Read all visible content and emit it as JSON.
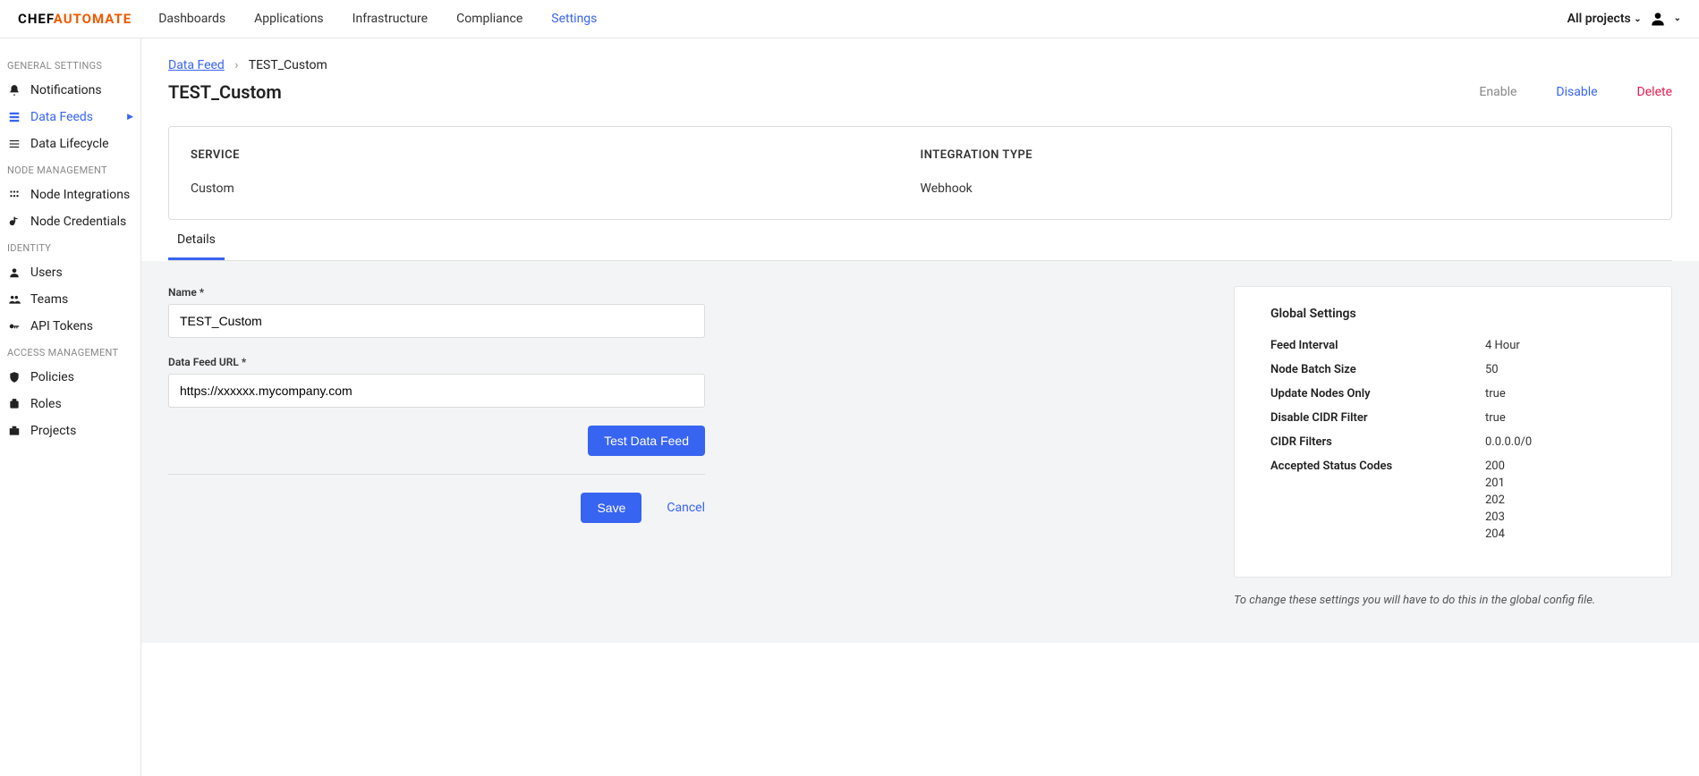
{
  "logo": {
    "chef": "CHEF",
    "automate": "AUTOMATE"
  },
  "topnav": [
    "Dashboards",
    "Applications",
    "Infrastructure",
    "Compliance",
    "Settings"
  ],
  "topnav_active": 4,
  "projects_label": "All projects",
  "sidebar": {
    "groups": [
      {
        "title": "GENERAL SETTINGS",
        "items": [
          {
            "label": "Notifications",
            "icon": "bell"
          },
          {
            "label": "Data Feeds",
            "icon": "feed",
            "active": true,
            "arrow": true
          },
          {
            "label": "Data Lifecycle",
            "icon": "lifecycle"
          }
        ]
      },
      {
        "title": "NODE MANAGEMENT",
        "items": [
          {
            "label": "Node Integrations",
            "icon": "nodeint"
          },
          {
            "label": "Node Credentials",
            "icon": "key"
          }
        ]
      },
      {
        "title": "IDENTITY",
        "items": [
          {
            "label": "Users",
            "icon": "user"
          },
          {
            "label": "Teams",
            "icon": "team"
          },
          {
            "label": "API Tokens",
            "icon": "token"
          }
        ]
      },
      {
        "title": "ACCESS MANAGEMENT",
        "items": [
          {
            "label": "Policies",
            "icon": "shield"
          },
          {
            "label": "Roles",
            "icon": "role"
          },
          {
            "label": "Projects",
            "icon": "project"
          }
        ]
      }
    ]
  },
  "breadcrumb": {
    "root": "Data Feed",
    "current": "TEST_Custom"
  },
  "page_title": "TEST_Custom",
  "actions": {
    "enable": "Enable",
    "disable": "Disable",
    "delete": "Delete"
  },
  "summary": {
    "service_label": "SERVICE",
    "service_value": "Custom",
    "integration_label": "INTEGRATION TYPE",
    "integration_value": "Webhook"
  },
  "tab": "Details",
  "form": {
    "name_label": "Name *",
    "name_value": "TEST_Custom",
    "url_label": "Data Feed URL *",
    "url_value": "https://xxxxxx.mycompany.com",
    "test_btn": "Test Data Feed",
    "save_btn": "Save",
    "cancel": "Cancel"
  },
  "global": {
    "title": "Global Settings",
    "rows": [
      {
        "label": "Feed Interval",
        "value": "4 Hour"
      },
      {
        "label": "Node Batch Size",
        "value": "50"
      },
      {
        "label": "Update Nodes Only",
        "value": "true"
      },
      {
        "label": "Disable CIDR Filter",
        "value": "true"
      },
      {
        "label": "CIDR Filters",
        "value": "0.0.0.0/0"
      }
    ],
    "codes_label": "Accepted Status Codes",
    "codes": [
      "200",
      "201",
      "202",
      "203",
      "204"
    ],
    "note": "To change these settings you will have to do this in the global config file."
  }
}
